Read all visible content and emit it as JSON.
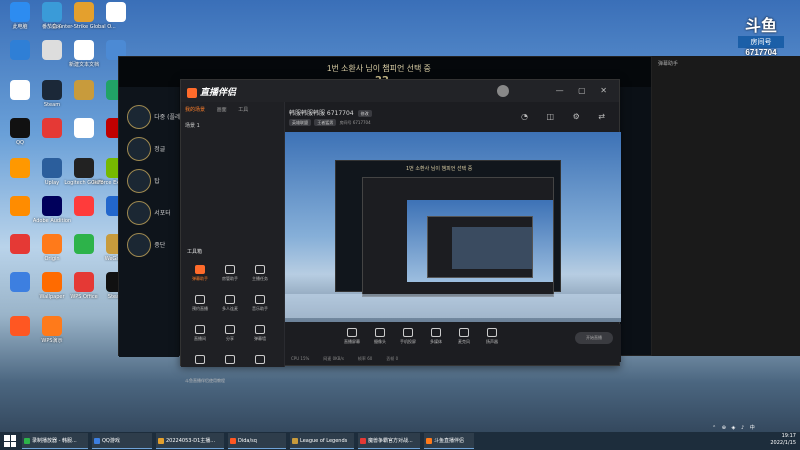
{
  "desktop": {
    "icons": [
      {
        "label": "此电脑",
        "color": "#2d8cf0"
      },
      {
        "label": "番茄盒子",
        "color": "#3a9bd8"
      },
      {
        "label": "Counter-Strike Global O...",
        "color": "#e4a02d"
      },
      {
        "label": "",
        "color": "#ffffff"
      },
      {
        "label": "",
        "color": "#2f7fd6"
      },
      {
        "label": "",
        "color": "#dddddd"
      },
      {
        "label": "新建文本文档",
        "color": "#ffffff"
      },
      {
        "label": "",
        "color": "#4c8ad4"
      },
      {
        "label": "",
        "color": "#ffffff"
      },
      {
        "label": "Steam",
        "color": "#1b2838"
      },
      {
        "label": "",
        "color": "#c89b3c"
      },
      {
        "label": "",
        "color": "#21a366"
      },
      {
        "label": "QQ",
        "color": "#111111"
      },
      {
        "label": "",
        "color": "#e53935"
      },
      {
        "label": "",
        "color": "#ffffff"
      },
      {
        "label": "",
        "color": "#c00000"
      },
      {
        "label": "",
        "color": "#ff9800"
      },
      {
        "label": "Uplay",
        "color": "#2b5e9c"
      },
      {
        "label": "Logitech G HUB",
        "color": "#222222"
      },
      {
        "label": "GeForce Experience",
        "color": "#76b900"
      },
      {
        "label": "",
        "color": "#ff8c00"
      },
      {
        "label": "Adobe Audition",
        "color": "#00005b"
      },
      {
        "label": "",
        "color": "#ff3b3b"
      },
      {
        "label": "",
        "color": "#2266cc"
      },
      {
        "label": "",
        "color": "#e53935"
      },
      {
        "label": "Origin",
        "color": "#ff7a1a"
      },
      {
        "label": "",
        "color": "#2db34a"
      },
      {
        "label": "WeGame",
        "color": "#c89b3c"
      },
      {
        "label": "",
        "color": "#3d7fe0"
      },
      {
        "label": "Wallpaper",
        "color": "#ff6b00"
      },
      {
        "label": "WPS Office",
        "color": "#e53935"
      },
      {
        "label": "Steam",
        "color": "#111111"
      },
      {
        "label": "",
        "color": "#ff5722"
      },
      {
        "label": "WPS演示",
        "color": "#ff7a1a"
      }
    ]
  },
  "room_badge": {
    "mark": "斗鱼",
    "label": "房间号",
    "number": "6717704"
  },
  "lol_client": {
    "title": "1번 소환사 님이 챔피언 선택 중",
    "timer": "22",
    "picks": [
      {
        "name": "다중 (플레이어)"
      },
      {
        "name": "정글"
      },
      {
        "name": "탑"
      },
      {
        "name": "서포터"
      },
      {
        "name": "중단"
      }
    ]
  },
  "right_panel": {
    "title": "弹幕助手"
  },
  "douyu_assistant": {
    "logo": "直播伴侣",
    "window_controls": "— ▢ ✕",
    "tabs": [
      "我的场景",
      "画面",
      "工具"
    ],
    "active_tab_index": 0,
    "scene_name": "场景 1",
    "room_title": "韩服韩服韩服 6717704",
    "edit_label": "修改",
    "category_tag": "英雄联盟",
    "sub_tag": "王者猛男",
    "room_meta": "房间号 6717704",
    "header_icons": "◔ ◫ ⚙ ⇄",
    "tools_title": "工具箱",
    "tools": [
      {
        "label": "弹幕助手",
        "highlight": true
      },
      {
        "label": "房管助手",
        "highlight": false
      },
      {
        "label": "主播任务",
        "highlight": false
      },
      {
        "label": "预约直播",
        "highlight": false
      },
      {
        "label": "多人连麦",
        "highlight": false
      },
      {
        "label": "音乐助手",
        "highlight": false
      },
      {
        "label": "直播间",
        "highlight": false
      },
      {
        "label": "分享",
        "highlight": false
      },
      {
        "label": "弹幕墙",
        "highlight": false
      },
      {
        "label": "",
        "highlight": false
      },
      {
        "label": "",
        "highlight": false
      },
      {
        "label": "",
        "highlight": false
      }
    ],
    "ad_text": "斗鱼直播伴侣使用教程",
    "controls": [
      "直播屏幕",
      "摄像头",
      "手机投屏",
      "多媒体",
      "麦克风",
      "扬声器"
    ],
    "start_button": "开始直播",
    "status": [
      "CPU 15%",
      "网速 0KB/s",
      "帧率 60",
      "丢帧 0"
    ]
  },
  "taskbar": {
    "items": [
      {
        "label": "录制播放器 - 韩服...",
        "color": "#2db34a"
      },
      {
        "label": "QQ游戏",
        "color": "#3d7fe0"
      },
      {
        "label": "20224053-D1主播...",
        "color": "#e4a02d"
      },
      {
        "label": "Dida/sq",
        "color": "#ff5722"
      },
      {
        "label": "League of Legends",
        "color": "#c89b3c"
      },
      {
        "label": "魔兽争霸官方对战...",
        "color": "#e53935"
      },
      {
        "label": "斗鱼直播伴侣",
        "color": "#ff7a1a"
      }
    ],
    "time": "19:17",
    "date": "2022/1/15",
    "tray_icons": "⌃ ⊕ ◈ ♪ 中"
  }
}
